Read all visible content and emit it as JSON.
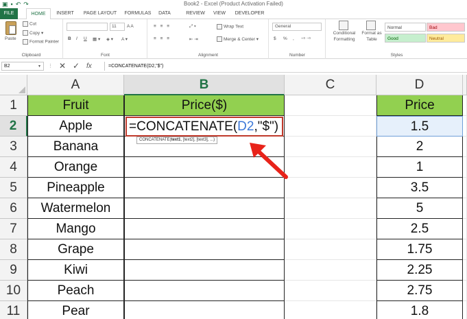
{
  "title_bar": {
    "title": "Book2 - Excel (Product Activation Failed)",
    "qat_icons": [
      "excel-logo-icon",
      "save-icon",
      "undo-icon",
      "redo-icon"
    ]
  },
  "ribbon_tabs": [
    "FILE",
    "HOME",
    "INSERT",
    "PAGE LAYOUT",
    "FORMULAS",
    "DATA",
    "REVIEW",
    "VIEW",
    "DEVELOPER"
  ],
  "active_tab": "HOME",
  "ribbon": {
    "clipboard": {
      "label": "Clipboard",
      "paste": "Paste",
      "cut": "Cut",
      "copy": "Copy",
      "format_painter": "Format Painter"
    },
    "font": {
      "label": "Font",
      "font_size": "11",
      "bold": "B",
      "italic": "I",
      "underline": "U"
    },
    "alignment": {
      "label": "Alignment",
      "wrap_text": "Wrap Text",
      "merge_center": "Merge & Center"
    },
    "number": {
      "label": "Number",
      "format": "General",
      "currency": "$",
      "percent": "%",
      "comma": ","
    },
    "styles": {
      "label": "Styles",
      "conditional_formatting": "Conditional Formatting",
      "format_as_table": "Format as Table",
      "normal": "Normal",
      "bad": "Bad",
      "good": "Good",
      "neutral": "Neutral"
    }
  },
  "formula_bar": {
    "name_box": "B2",
    "formula": "=CONCATENATE(D2,\"$\")"
  },
  "columns": [
    "A",
    "B",
    "C",
    "D"
  ],
  "rows": [
    "1",
    "2",
    "3",
    "4",
    "5",
    "6",
    "7",
    "8",
    "9",
    "10",
    "11"
  ],
  "header_row": {
    "a": "Fruit",
    "b": "Price($)",
    "d": "Price"
  },
  "fruits": [
    "Apple",
    "Banana",
    "Orange",
    "Pineapple",
    "Watermelon",
    "Mango",
    "Grape",
    "Kiwi",
    "Peach",
    "Pear"
  ],
  "prices": [
    "1.5",
    "2",
    "1",
    "3.5",
    "5",
    "2.5",
    "1.75",
    "2.25",
    "2.75",
    "1.8"
  ],
  "editing_cell": {
    "prefix": "=CONCATENATE(",
    "ref": "D2",
    "suffix": ",\"$\")"
  },
  "tooltip": {
    "fn": "CONCATENATE(",
    "arg1": "text1",
    "rest": ", [text2], [text3], ...)"
  },
  "colors": {
    "excel_green": "#217346",
    "header_fill": "#92d050",
    "edit_border": "#c0392b",
    "ref_blue": "#3c78d8",
    "arrow_red": "#e8231a"
  }
}
